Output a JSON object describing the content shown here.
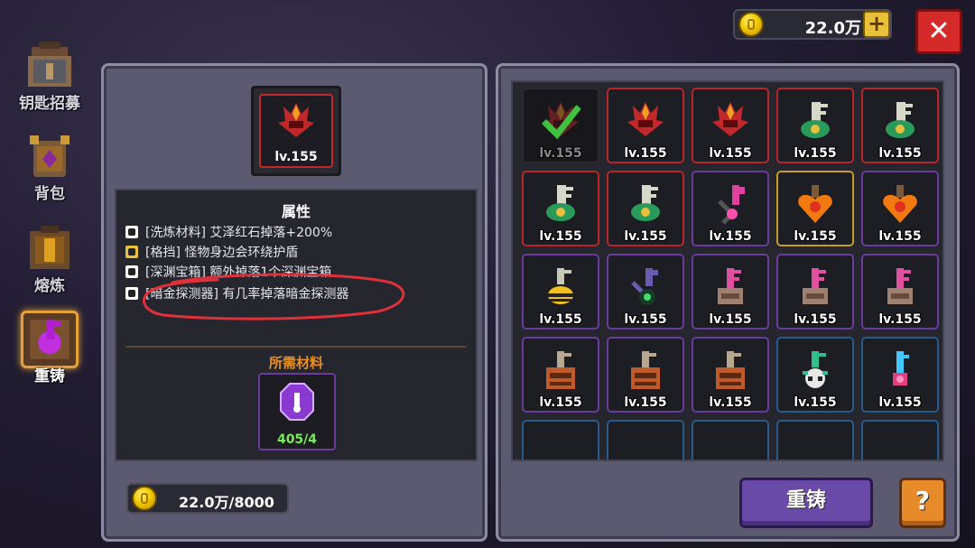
{
  "nav": {
    "items": [
      {
        "label": "钥匙招募",
        "icon": "key-recruit-icon"
      },
      {
        "label": "背包",
        "icon": "backpack-icon"
      },
      {
        "label": "熔炼",
        "icon": "smelt-icon"
      },
      {
        "label": "重铸",
        "icon": "reforge-icon",
        "selected": true
      }
    ]
  },
  "currency": {
    "amount": "22.0万",
    "add_label": "+"
  },
  "close_label": "✕",
  "detail": {
    "item_level": "lv.155",
    "attributes_title": "属性",
    "attributes": [
      {
        "text": "[洗炼材料] 艾泽红石掉落+200%"
      },
      {
        "text": "[格挡] 怪物身边会环绕护盾"
      },
      {
        "text": "[深渊宝箱] 额外掉落1个深渊宝箱"
      },
      {
        "text": "[暗金探测器] 有几率掉落暗金探测器",
        "highlighted": true
      }
    ],
    "materials_title": "所需材料",
    "material_count": "405/4",
    "cost": "22.0万/8000"
  },
  "grid": {
    "items": [
      {
        "level": "lv.155",
        "kind": "demon",
        "rarity": "red",
        "dim": true,
        "checked": true
      },
      {
        "level": "lv.155",
        "kind": "demon",
        "rarity": "red"
      },
      {
        "level": "lv.155",
        "kind": "demon",
        "rarity": "red"
      },
      {
        "level": "lv.155",
        "kind": "key-green",
        "rarity": "red"
      },
      {
        "level": "lv.155",
        "kind": "key-green",
        "rarity": "red"
      },
      {
        "level": "lv.155",
        "kind": "key-green",
        "rarity": "red"
      },
      {
        "level": "lv.155",
        "kind": "key-green",
        "rarity": "red"
      },
      {
        "level": "lv.155",
        "kind": "key-pink",
        "rarity": "purple"
      },
      {
        "level": "lv.155",
        "kind": "heart",
        "rarity": "gold"
      },
      {
        "level": "lv.155",
        "kind": "heart",
        "rarity": "purple"
      },
      {
        "level": "lv.155",
        "kind": "key-bee",
        "rarity": "purple"
      },
      {
        "level": "lv.155",
        "kind": "key-dark",
        "rarity": "purple"
      },
      {
        "level": "lv.155",
        "kind": "key-pink2",
        "rarity": "purple"
      },
      {
        "level": "lv.155",
        "kind": "key-pink2",
        "rarity": "purple"
      },
      {
        "level": "lv.155",
        "kind": "key-pink2",
        "rarity": "purple"
      },
      {
        "level": "lv.155",
        "kind": "key-chest",
        "rarity": "purple"
      },
      {
        "level": "lv.155",
        "kind": "key-chest",
        "rarity": "purple"
      },
      {
        "level": "lv.155",
        "kind": "key-chest",
        "rarity": "purple"
      },
      {
        "level": "lv.155",
        "kind": "key-skull",
        "rarity": "blue"
      },
      {
        "level": "lv.155",
        "kind": "key-blue",
        "rarity": "blue"
      }
    ]
  },
  "reforge_label": "重铸",
  "help_label": "?",
  "colors": {
    "red": "#b8262a",
    "purple": "#6a3a9c",
    "gold": "#c99a2c",
    "blue": "#2a5a8a",
    "accent_orange": "#e6902a",
    "highlight_circle": "#e0303a"
  }
}
